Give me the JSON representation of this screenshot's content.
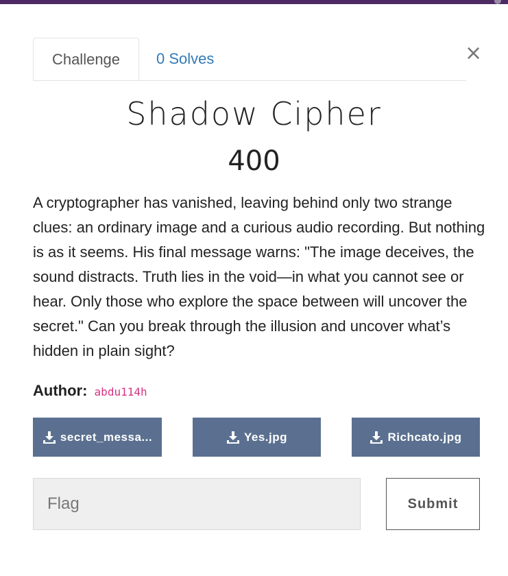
{
  "tabs": {
    "challenge_label": "Challenge",
    "solves_label": "0 Solves"
  },
  "close_symbol": "×",
  "challenge": {
    "name": "Shadow Cipher",
    "points": "400",
    "description": "A cryptographer has vanished, leaving behind only two strange clues: an ordinary image and a curious audio recording. But nothing is as it seems. His final message warns: \"The image deceives, the sound distracts. Truth lies in the void—in what you cannot see or hear. Only those who explore the space between will uncover the secret.\" Can you break through the illusion and uncover what’s hidden in plain sight?",
    "author_label": "Author:",
    "author_name": "abdu114h"
  },
  "files": [
    {
      "label": "secret_messa...",
      "icon": "download-icon"
    },
    {
      "label": "Yes.jpg",
      "icon": "download-icon"
    },
    {
      "label": "Richcato.jpg",
      "icon": "download-icon"
    }
  ],
  "flag_form": {
    "placeholder": "Flag",
    "value": "",
    "submit_label": "Submit"
  },
  "colors": {
    "top_bar": "#4d2a63",
    "file_button": "#5b7090",
    "link": "#337ab7",
    "author_code": "#d63384"
  }
}
